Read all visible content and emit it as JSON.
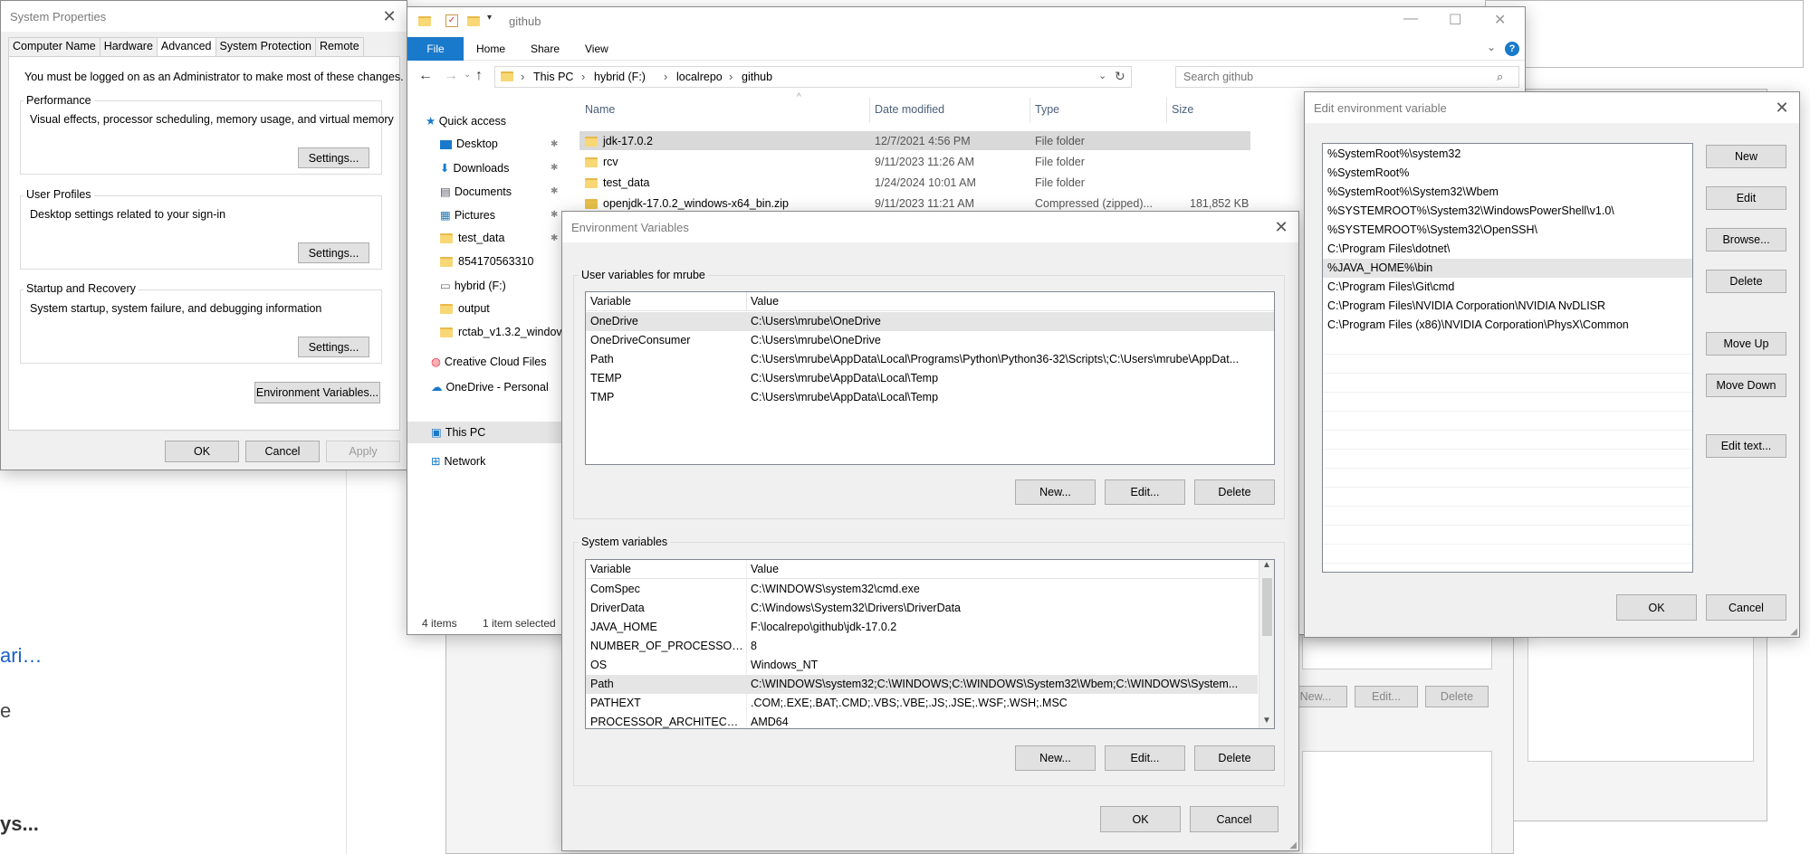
{
  "bg": {
    "link_text": "ari…",
    "letter_e": "e",
    "bold_text": "ys..."
  },
  "sysprops": {
    "title": "System Properties",
    "tabs": [
      "Computer Name",
      "Hardware",
      "Advanced",
      "System Protection",
      "Remote"
    ],
    "admin_note": "You must be logged on as an Administrator to make most of these changes.",
    "perf_label": "Performance",
    "perf_desc": "Visual effects, processor scheduling, memory usage, and virtual memory",
    "profiles_label": "User Profiles",
    "profiles_desc": "Desktop settings related to your sign-in",
    "startup_label": "Startup and Recovery",
    "startup_desc": "System startup, system failure, and debugging information",
    "settings_btn": "Settings...",
    "env_btn": "Environment Variables...",
    "ok": "OK",
    "cancel": "Cancel",
    "apply": "Apply"
  },
  "explorer": {
    "title": "github",
    "ribbon": [
      "File",
      "Home",
      "Share",
      "View"
    ],
    "crumbs": [
      "This PC",
      "hybrid (F:)",
      "localrepo",
      "github"
    ],
    "search_placeholder": "Search github",
    "nav": [
      "Quick access",
      "Desktop",
      "Downloads",
      "Documents",
      "Pictures",
      "test_data",
      "854170563310",
      "hybrid (F:)",
      "output",
      "rctab_v1.3.2_windov",
      "Creative Cloud Files",
      "OneDrive - Personal",
      "This PC",
      "Network"
    ],
    "columns": [
      "Name",
      "Date modified",
      "Type",
      "Size"
    ],
    "files": [
      {
        "name": "jdk-17.0.2",
        "date": "12/7/2021 4:56 PM",
        "type": "File folder",
        "size": ""
      },
      {
        "name": "rcv",
        "date": "9/11/2023 11:26 AM",
        "type": "File folder",
        "size": ""
      },
      {
        "name": "test_data",
        "date": "1/24/2024 10:01 AM",
        "type": "File folder",
        "size": ""
      },
      {
        "name": "openjdk-17.0.2_windows-x64_bin.zip",
        "date": "9/11/2023 11:21 AM",
        "type": "Compressed (zipped)...",
        "size": "181,852 KB"
      }
    ],
    "status_items": "4 items",
    "status_selected": "1 item selected"
  },
  "envvars": {
    "title": "Environment Variables",
    "user_label": "User variables for mrube",
    "col_var": "Variable",
    "col_val": "Value",
    "user_vars": [
      {
        "name": "OneDrive",
        "value": "C:\\Users\\mrube\\OneDrive"
      },
      {
        "name": "OneDriveConsumer",
        "value": "C:\\Users\\mrube\\OneDrive"
      },
      {
        "name": "Path",
        "value": "C:\\Users\\mrube\\AppData\\Local\\Programs\\Python\\Python36-32\\Scripts\\;C:\\Users\\mrube\\AppDat..."
      },
      {
        "name": "TEMP",
        "value": "C:\\Users\\mrube\\AppData\\Local\\Temp"
      },
      {
        "name": "TMP",
        "value": "C:\\Users\\mrube\\AppData\\Local\\Temp"
      }
    ],
    "system_label": "System variables",
    "sys_vars": [
      {
        "name": "ComSpec",
        "value": "C:\\WINDOWS\\system32\\cmd.exe"
      },
      {
        "name": "DriverData",
        "value": "C:\\Windows\\System32\\Drivers\\DriverData"
      },
      {
        "name": "JAVA_HOME",
        "value": "F:\\localrepo\\github\\jdk-17.0.2"
      },
      {
        "name": "NUMBER_OF_PROCESSORS",
        "value": "8"
      },
      {
        "name": "OS",
        "value": "Windows_NT"
      },
      {
        "name": "Path",
        "value": "C:\\WINDOWS\\system32;C:\\WINDOWS;C:\\WINDOWS\\System32\\Wbem;C:\\WINDOWS\\System..."
      },
      {
        "name": "PATHEXT",
        "value": ".COM;.EXE;.BAT;.CMD;.VBS;.VBE;.JS;.JSE;.WSF;.WSH;.MSC"
      },
      {
        "name": "PROCESSOR_ARCHITECTURE",
        "value": "AMD64"
      }
    ],
    "new_btn": "New...",
    "edit_btn": "Edit...",
    "delete_btn": "Delete",
    "ok": "OK",
    "cancel": "Cancel"
  },
  "editenv": {
    "title": "Edit environment variable",
    "entries": [
      "%SystemRoot%\\system32",
      "%SystemRoot%",
      "%SystemRoot%\\System32\\Wbem",
      "%SYSTEMROOT%\\System32\\WindowsPowerShell\\v1.0\\",
      "%SYSTEMROOT%\\System32\\OpenSSH\\",
      "C:\\Program Files\\dotnet\\",
      "%JAVA_HOME%\\bin",
      "C:\\Program Files\\Git\\cmd",
      "C:\\Program Files\\NVIDIA Corporation\\NVIDIA NvDLISR",
      "C:\\Program Files (x86)\\NVIDIA Corporation\\PhysX\\Common"
    ],
    "buttons": [
      "New",
      "Edit",
      "Browse...",
      "Delete",
      "Move Up",
      "Move Down",
      "Edit text..."
    ],
    "ok": "OK",
    "cancel": "Cancel"
  },
  "behind": {
    "new": "New...",
    "edit": "Edit...",
    "delete": "Delete"
  }
}
